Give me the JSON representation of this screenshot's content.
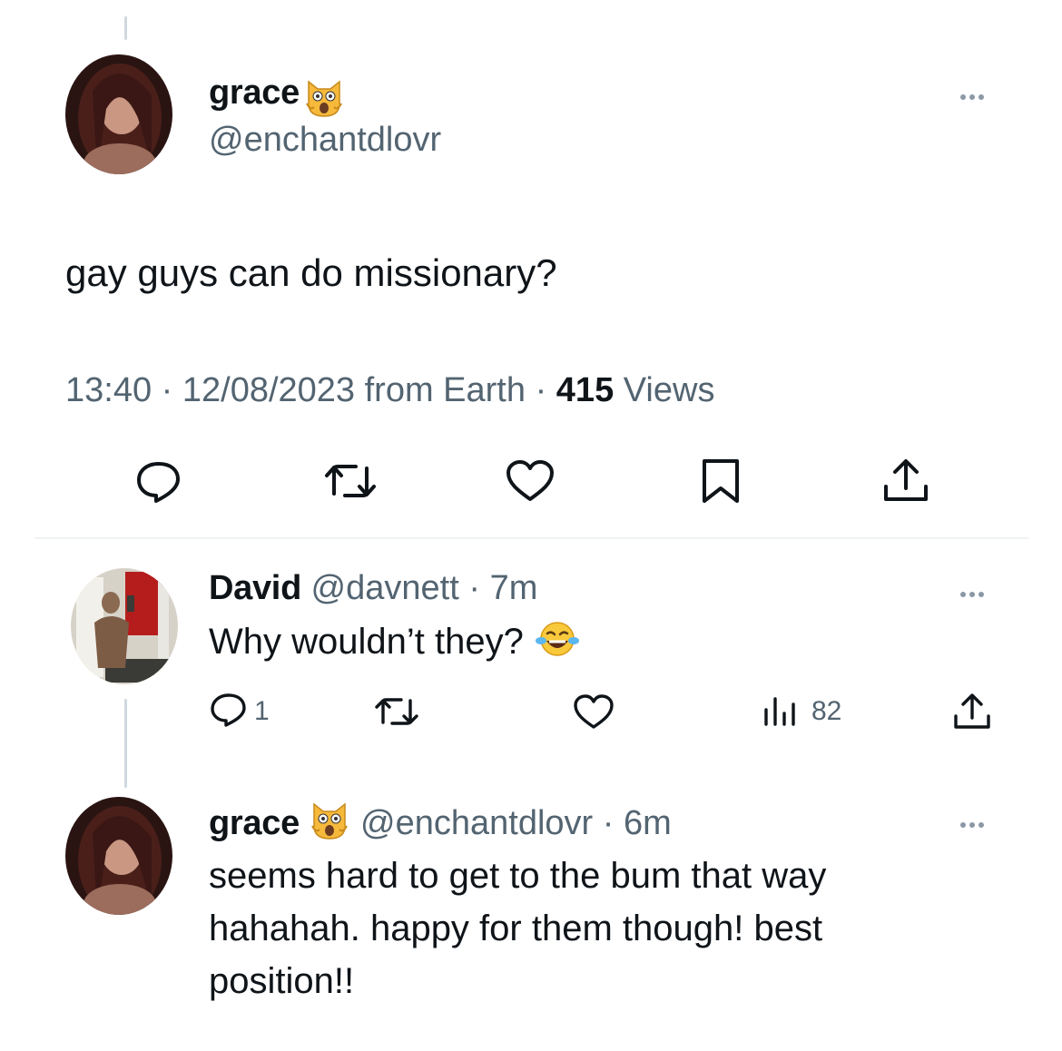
{
  "main_tweet": {
    "display_name": "grace",
    "handle": "@enchantdlovr",
    "text": "gay guys can do missionary?",
    "time": "13:40",
    "date_location": "12/08/2023 from Earth",
    "views_count": "415",
    "views_label": "Views"
  },
  "replies": [
    {
      "display_name": "David",
      "handle": "@davnett",
      "age": "7m",
      "text": "Why wouldn’t they?",
      "reply_count": "1",
      "views_count": "82"
    },
    {
      "display_name": "grace",
      "handle": "@enchantdlovr",
      "age": "6m",
      "text_lines": [
        "seems hard to get to the bum that way",
        "hahahah. happy for them though! best",
        "position!!"
      ]
    }
  ],
  "separators": {
    "dot": "·"
  },
  "colors": {
    "text": "#0f1419",
    "secondary": "#536471",
    "divider": "#eff3f4",
    "thread_line": "#cfd9de"
  },
  "icons": [
    "reply-icon",
    "retweet-icon",
    "like-icon",
    "bookmark-icon",
    "share-icon",
    "views-icon",
    "more-icon",
    "scream-cat-emoji",
    "laughing-emoji"
  ]
}
